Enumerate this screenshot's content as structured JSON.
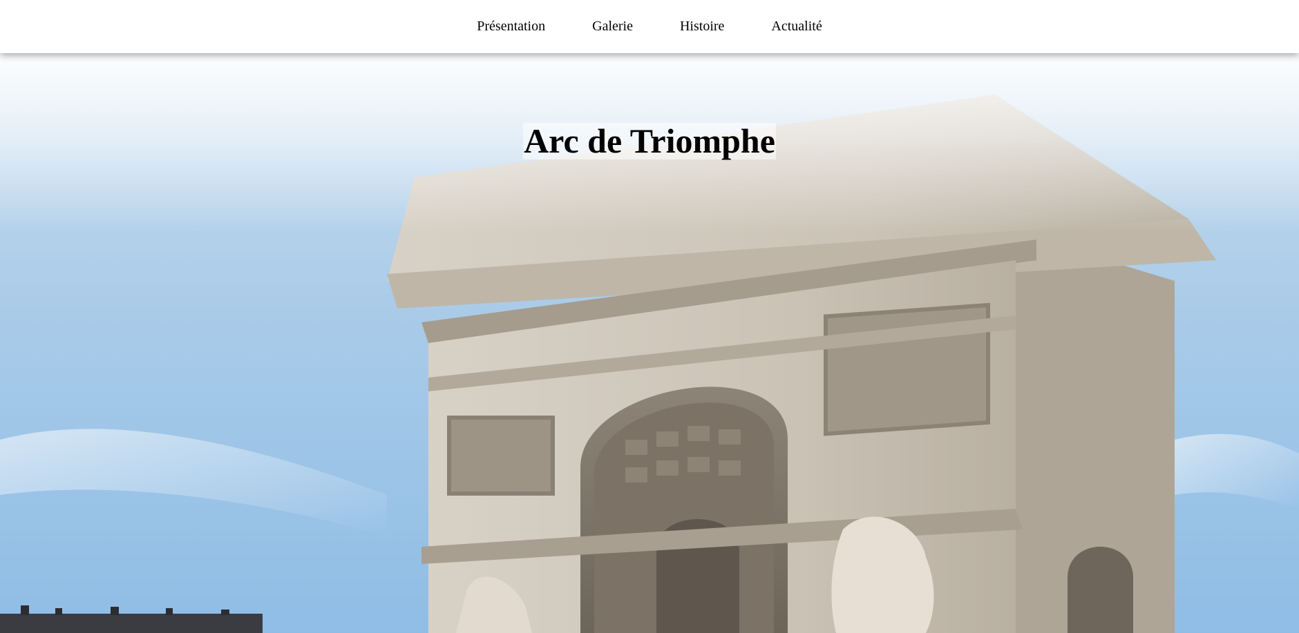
{
  "nav": {
    "items": [
      {
        "label": "Présentation"
      },
      {
        "label": "Galerie"
      },
      {
        "label": "Histoire"
      },
      {
        "label": "Actualité"
      }
    ]
  },
  "hero": {
    "title": "Arc de Triomphe",
    "image_subject": "arc-de-triomphe-photo"
  },
  "colors": {
    "sky": "#a9cbe8",
    "stone": "#cfc7bb",
    "nav_bg": "#ffffff"
  }
}
